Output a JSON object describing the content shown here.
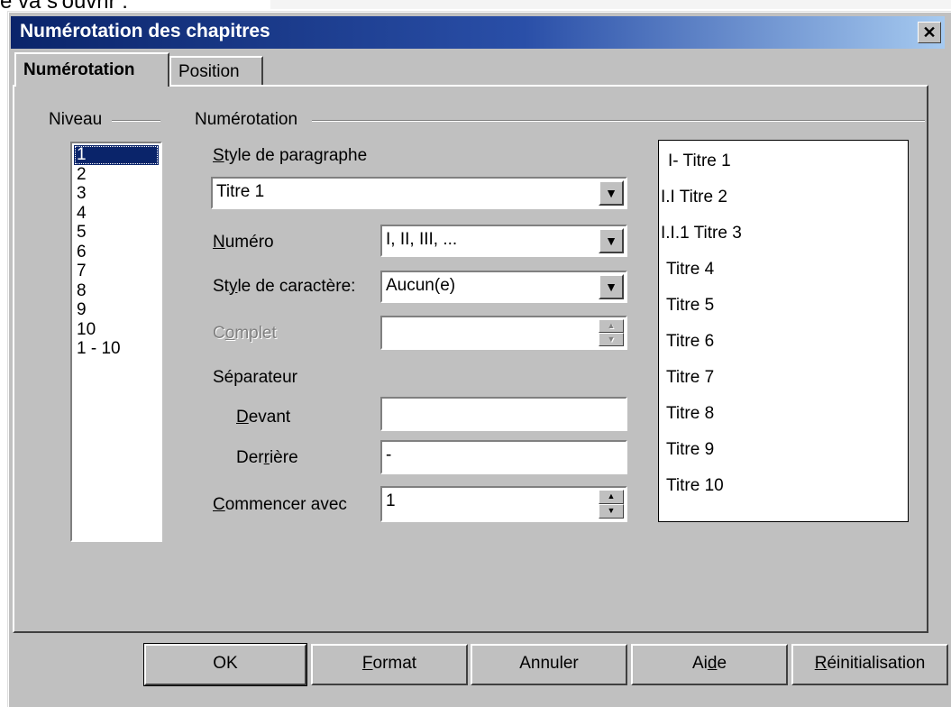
{
  "background_text": "e va s'ouvrir :",
  "dialog": {
    "title": "Numérotation des chapitres",
    "close_glyph": "✕",
    "tabs": [
      {
        "label": "Numérotation",
        "active": true
      },
      {
        "label": "Position",
        "active": false
      }
    ]
  },
  "niveau": {
    "group_label": "Niveau",
    "items": [
      "1",
      "2",
      "3",
      "4",
      "5",
      "6",
      "7",
      "8",
      "9",
      "10",
      "1 - 10"
    ],
    "selected": "1"
  },
  "numerotation": {
    "group_label": "Numérotation",
    "style_paragraphe_label": "Style de paragraphe",
    "style_paragraphe_value": "Titre 1",
    "numero_label": "Numéro",
    "numero_value": "I, II, III, ...",
    "style_caractere_label": "Style de caractère:",
    "style_caractere_value": "Aucun(e)",
    "complet_label": "Complet",
    "complet_value": "",
    "separateur_label": "Séparateur",
    "devant_label": "Devant",
    "devant_value": "",
    "derriere_label": "Derrière",
    "derriere_value": "-",
    "commencer_label": "Commencer avec",
    "commencer_value": "1"
  },
  "preview": [
    "I- Titre 1",
    "I.I Titre 2",
    "I.I.1 Titre 3",
    "Titre 4",
    "Titre 5",
    "Titre 6",
    "Titre 7",
    "Titre 8",
    "Titre 9",
    "Titre 10"
  ],
  "buttons": {
    "ok": "OK",
    "format": "Format",
    "annuler": "Annuler",
    "aide": "Aide",
    "reinitialisation": "Réinitialisation"
  },
  "icons": {
    "dropdown": "triangle-down",
    "spin": "up-down-arrows"
  }
}
